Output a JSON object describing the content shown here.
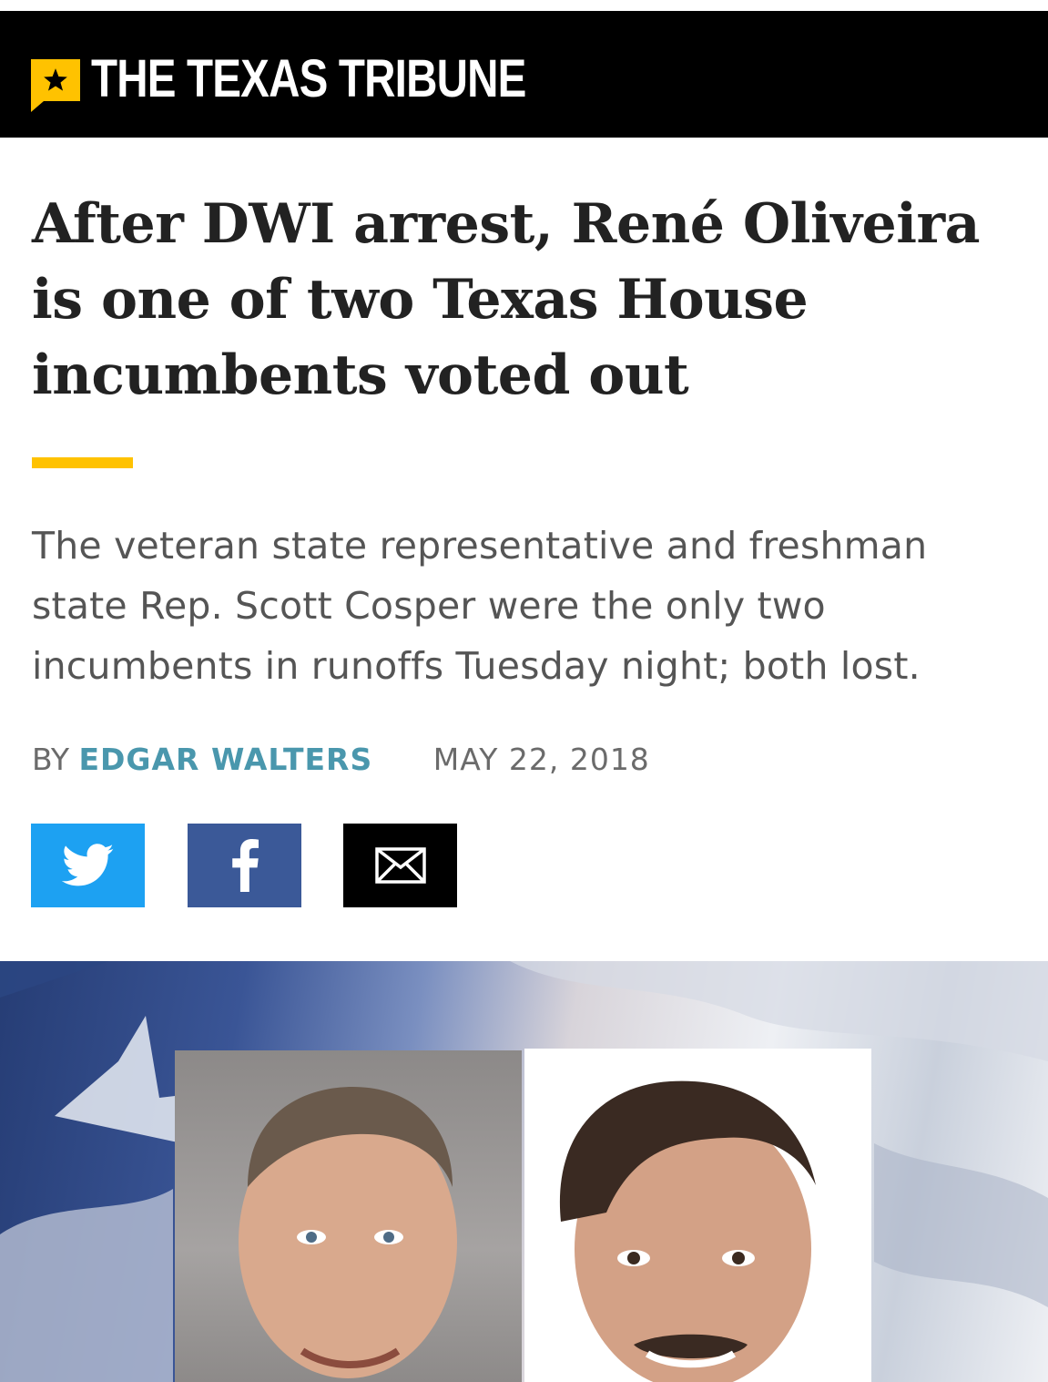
{
  "masthead": {
    "logo_icon": "star-icon",
    "title": "THE TEXAS TRIBUNE",
    "bg_color": "#000000",
    "accent_color": "#ffc200"
  },
  "article": {
    "headline": "After DWI arrest, René Oliveira is one of two Texas House incumbents voted out",
    "dek": "The veteran state representative and freshman state Rep. Scott Cosper were the only two incumbents in runoffs Tuesday night; both lost.",
    "byline_prefix": "BY",
    "author": "EDGAR WALTERS",
    "date": "MAY 22, 2018",
    "author_color": "#4a97ad"
  },
  "share": {
    "twitter": {
      "icon": "twitter-bird-icon",
      "color": "#1da1f2"
    },
    "facebook": {
      "icon": "facebook-f-icon",
      "color": "#3b5998"
    },
    "email": {
      "icon": "envelope-icon",
      "color": "#000000"
    }
  }
}
